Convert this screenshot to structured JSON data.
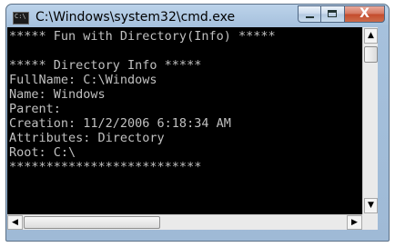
{
  "window": {
    "title": "C:\\Windows\\system32\\cmd.exe",
    "app_icon_glyph": "C:\\",
    "buttons": {
      "minimize_icon": "minimize-icon",
      "maximize_icon": "maximize-icon",
      "close_icon": "close-icon",
      "close_glyph": "X"
    }
  },
  "console": {
    "text_color": "#c0c0c0",
    "background": "#000000",
    "lines": [
      "***** Fun with Directory(Info) *****",
      "",
      "***** Directory Info *****",
      "FullName: C:\\Windows",
      "Name: Windows",
      "Parent:",
      "Creation: 11/2/2006 6:18:34 AM",
      "Attributes: Directory",
      "Root: C:\\",
      "**************************"
    ]
  },
  "scrollbars": {
    "up_arrow": "▲",
    "down_arrow": "▼",
    "left_arrow": "◀",
    "right_arrow": "▶"
  }
}
